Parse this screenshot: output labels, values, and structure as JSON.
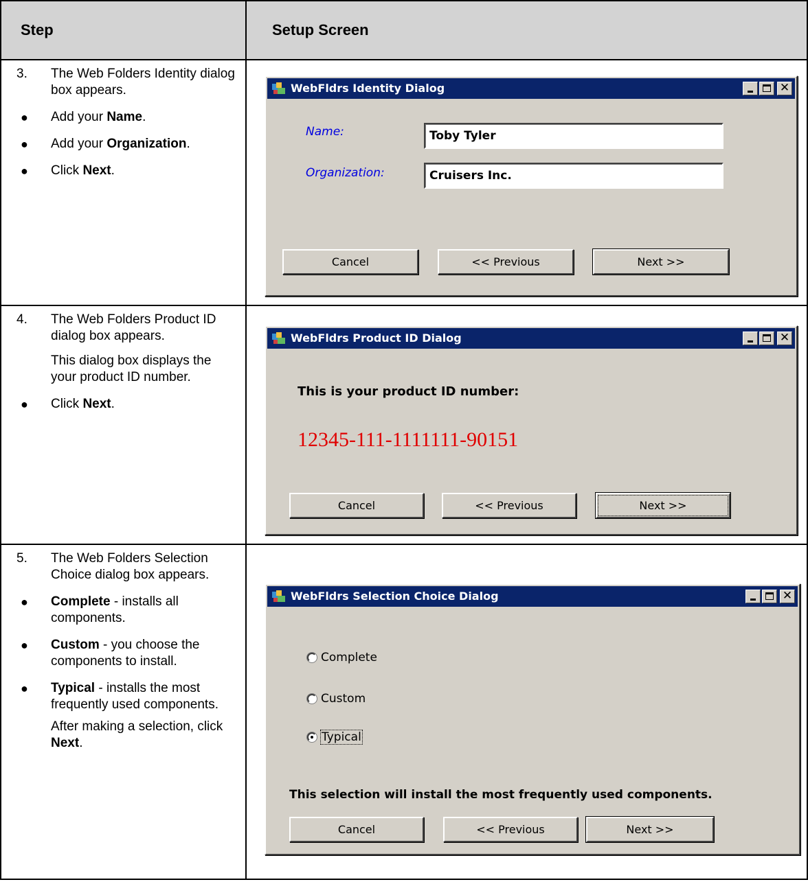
{
  "header": {
    "step": "Step",
    "screen": "Setup Screen"
  },
  "rows": [
    {
      "step": {
        "num": "3.",
        "lines": "The Web Folders Identity dialog box appears.",
        "bullets": [
          {
            "pre": "Add your ",
            "bold": "Name",
            "post": "."
          },
          {
            "pre": "Add your ",
            "bold": "Organization",
            "post": "."
          },
          {
            "pre": "Click ",
            "bold": "Next",
            "post": "."
          }
        ]
      },
      "dialog": {
        "title": "WebFldrs Identity Dialog",
        "name_label": "Name:",
        "name_value": "Toby Tyler",
        "org_label": "Organization:",
        "org_value": "Cruisers Inc.",
        "cancel": "Cancel",
        "previous": "<< Previous",
        "next": "Next >>"
      }
    },
    {
      "step": {
        "num": "4.",
        "lines": "The Web Folders Product ID dialog box appears.",
        "para": "This dialog box displays the your product ID number.",
        "bullets": [
          {
            "pre": "Click ",
            "bold": "Next",
            "post": "."
          }
        ]
      },
      "dialog": {
        "title": "WebFldrs Product ID Dialog",
        "heading": "This is your product ID number:",
        "product_id": "12345-111-1111111-90151",
        "cancel": "Cancel",
        "previous": "<< Previous",
        "next": "Next >>"
      }
    },
    {
      "step": {
        "num": "5.",
        "lines": "The Web Folders Selection Choice dialog box appears.",
        "bullets": [
          {
            "pre": "",
            "bold": "Complete",
            "post": " - installs all components."
          },
          {
            "pre": "",
            "bold": "Custom",
            "post": " - you choose the components to install."
          },
          {
            "pre": "",
            "bold": "Typical",
            "post": " - installs the most frequently used components."
          }
        ],
        "para_pre": "After making a selection, click ",
        "para_bold": "Next",
        "para_post": "."
      },
      "dialog": {
        "title": "WebFldrs Selection Choice Dialog",
        "options": [
          "Complete",
          "Custom",
          "Typical"
        ],
        "selected": "Typical",
        "description": "This selection will install the most frequently used components.",
        "cancel": "Cancel",
        "previous": "<< Previous",
        "next": "Next >>"
      }
    }
  ]
}
